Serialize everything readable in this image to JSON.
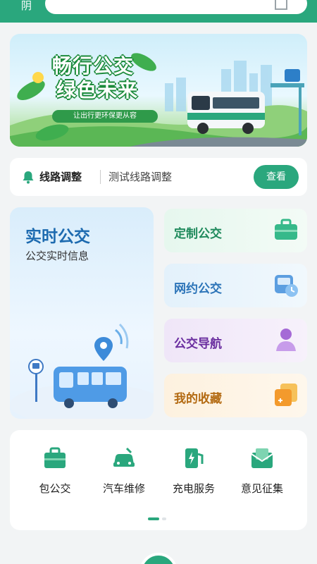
{
  "header": {
    "weather": "阴",
    "search_icon": "scan-icon"
  },
  "banner": {
    "line1": "畅行公交",
    "line2": "绿色未来",
    "subtitle": "让出行更环保更从容",
    "active_index": 0,
    "dot_count": 2
  },
  "notice": {
    "title": "线路调整",
    "text": "测试线路调整",
    "button": "查看",
    "icon": "bell-icon"
  },
  "main_card": {
    "title": "实时公交",
    "subtitle": "公交实时信息"
  },
  "cards": {
    "custom": {
      "label": "定制公交",
      "icon": "briefcase-icon"
    },
    "online": {
      "label": "网约公交",
      "icon": "bus-clock-icon"
    },
    "navigation": {
      "label": "公交导航",
      "icon": "person-pin-icon"
    },
    "favorites": {
      "label": "我的收藏",
      "icon": "stacked-folder-icon"
    }
  },
  "services": {
    "items": [
      {
        "label": "包公交",
        "icon": "briefcase-icon"
      },
      {
        "label": "汽车维修",
        "icon": "car-repair-icon"
      },
      {
        "label": "充电服务",
        "icon": "charging-station-icon"
      },
      {
        "label": "意见征集",
        "icon": "mail-feedback-icon"
      }
    ],
    "active_page": 0,
    "page_count": 2
  },
  "colors": {
    "primary": "#2aa77d",
    "realtime_blue": "#1e6bb0",
    "online_blue": "#2c74b8",
    "nav_purple": "#6b2fa0",
    "fav_orange": "#b36a12"
  }
}
